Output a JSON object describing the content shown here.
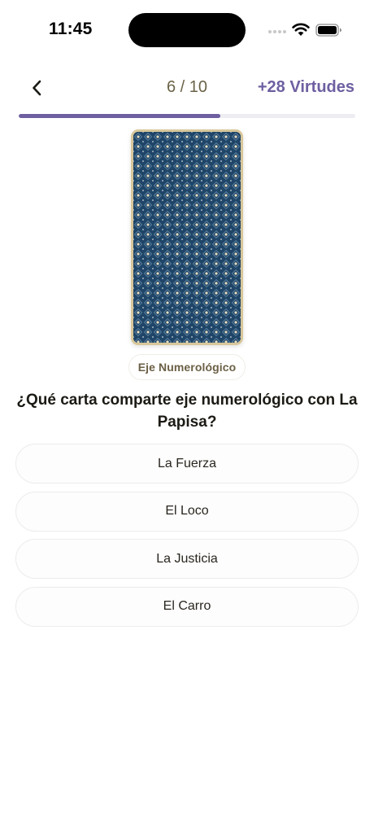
{
  "status_bar": {
    "time": "11:45"
  },
  "header": {
    "counter": "6 / 10",
    "reward": "+28 Virtudes"
  },
  "progress": {
    "fraction": 0.6,
    "fill_color": "#6e5fa1",
    "track_color": "#eeedf2"
  },
  "card": {
    "face": "card-back",
    "background_color": "#1f4568",
    "border_color": "#d8c79a"
  },
  "quiz": {
    "category": "Eje Numerológico",
    "question": "¿Qué carta comparte eje numerológico con La Papisa?",
    "options": [
      {
        "label": "La Fuerza"
      },
      {
        "label": "El Loco"
      },
      {
        "label": "La Justicia"
      },
      {
        "label": "El Carro"
      }
    ]
  },
  "icons": {
    "back": "chevron-left-icon",
    "signal": "cellular-signal-icon",
    "wifi": "wifi-icon",
    "battery": "battery-icon"
  },
  "colors": {
    "accent": "#6e5fa1",
    "muted_text": "#6b6347"
  }
}
